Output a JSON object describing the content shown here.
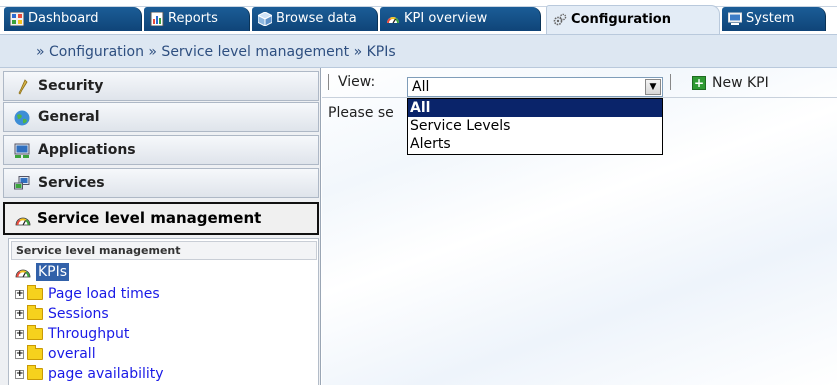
{
  "tabs": [
    {
      "label": "Dashboard",
      "icon": "dashboard-icon",
      "active": false
    },
    {
      "label": "Reports",
      "icon": "reports-icon",
      "active": false
    },
    {
      "label": "Browse data",
      "icon": "cube-icon",
      "active": false
    },
    {
      "label": "KPI overview",
      "icon": "gauge-icon",
      "active": false
    },
    {
      "label": "Configuration",
      "icon": "gears-icon",
      "active": true
    },
    {
      "label": "System",
      "icon": "monitor-icon",
      "active": false
    }
  ],
  "breadcrumb": "» Configuration » Service level management » KPIs",
  "sidebar": {
    "sections": [
      {
        "label": "Security",
        "icon": "wrench-icon"
      },
      {
        "label": "General",
        "icon": "globe-icon"
      },
      {
        "label": "Applications",
        "icon": "applications-icon"
      },
      {
        "label": "Services",
        "icon": "services-icon"
      },
      {
        "label": "Service level management",
        "icon": "gauge-icon",
        "selected": true
      }
    ],
    "tree": {
      "header": "Service level management",
      "root": "KPIs",
      "items": [
        "Page load times",
        "Sessions",
        "Throughput",
        "overall",
        "page availability"
      ]
    }
  },
  "toolbar": {
    "view_label": "View:",
    "view_value": "All",
    "new_kpi_label": "New KPI"
  },
  "main": {
    "message": "Please se"
  },
  "dropdown": {
    "options": [
      "All",
      "Service Levels",
      "Alerts"
    ],
    "highlighted": 0
  },
  "colors": {
    "tab_blue": "#1b5d97",
    "breadcrumb_bg": "#dde7f2",
    "link": "#1a1ae6",
    "highlight": "#0a246a"
  }
}
